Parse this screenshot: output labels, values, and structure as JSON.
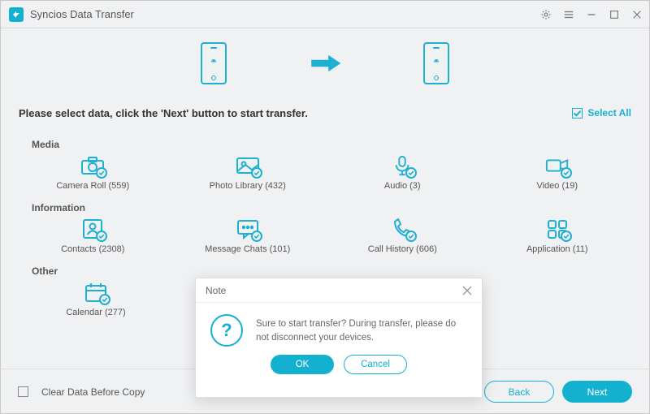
{
  "app": {
    "title": "Syncios Data Transfer"
  },
  "instruction": "Please select data, click the 'Next' button to start transfer.",
  "select_all": "Select All",
  "sections": {
    "media": {
      "header": "Media",
      "camera_roll": "Camera Roll (559)",
      "photo_library": "Photo Library (432)",
      "audio": "Audio (3)",
      "video": "Video (19)"
    },
    "information": {
      "header": "Information",
      "contacts": "Contacts (2308)",
      "message_chats": "Message Chats (101)",
      "call_history": "Call History (606)",
      "application": "Application (11)"
    },
    "other": {
      "header": "Other",
      "calendar": "Calendar (277)"
    }
  },
  "footer": {
    "clear": "Clear Data Before Copy",
    "back": "Back",
    "next": "Next"
  },
  "dialog": {
    "title": "Note",
    "message": "Sure to start transfer? During transfer, please do not disconnect your devices.",
    "ok": "OK",
    "cancel": "Cancel"
  },
  "colors": {
    "accent": "#13b1cf"
  }
}
